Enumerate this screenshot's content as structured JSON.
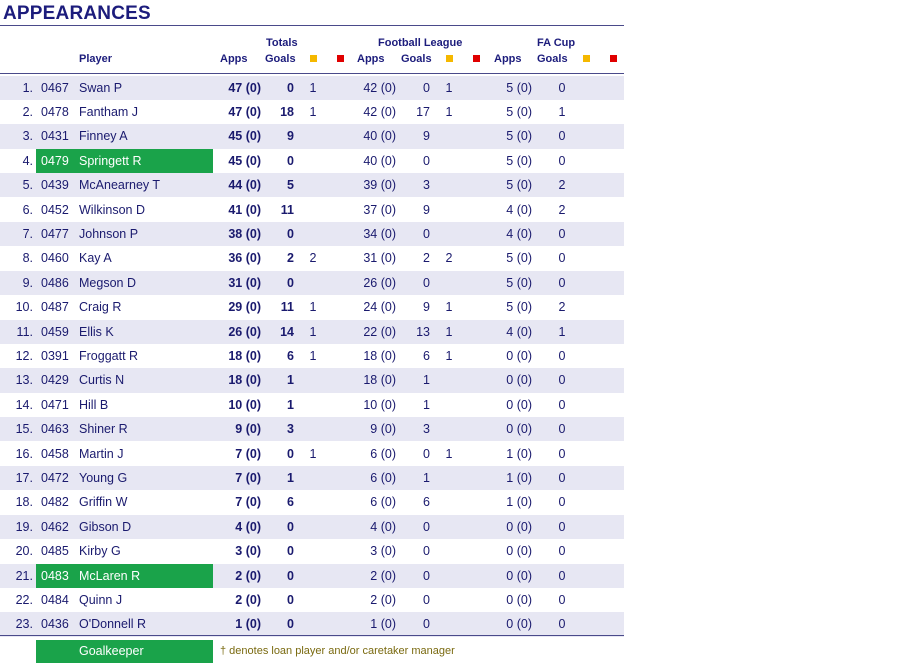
{
  "title": "APPEARANCES",
  "headers": {
    "player": "Player",
    "totals": "Totals",
    "football_league": "Football League",
    "fa_cup": "FA Cup",
    "apps": "Apps",
    "goals": "Goals"
  },
  "colors": {
    "yellow_card": "#f5b800",
    "red_card": "#e00000",
    "goalkeeper": "#1aa34a",
    "alt_row": "#e7e7f3",
    "text": "#1a1a6e"
  },
  "rows": [
    {
      "rank": "1.",
      "id": "0467",
      "name": "Swan P",
      "tot_apps": "47 (0)",
      "tot_goals": "0",
      "tot_y": "1",
      "tot_r": "",
      "fl_apps": "42 (0)",
      "fl_goals": "0",
      "fl_y": "1",
      "fl_r": "",
      "fa_apps": "5 (0)",
      "fa_goals": "0",
      "fa_y": "",
      "fa_r": "",
      "gk": false
    },
    {
      "rank": "2.",
      "id": "0478",
      "name": "Fantham J",
      "tot_apps": "47 (0)",
      "tot_goals": "18",
      "tot_y": "1",
      "tot_r": "",
      "fl_apps": "42 (0)",
      "fl_goals": "17",
      "fl_y": "1",
      "fl_r": "",
      "fa_apps": "5 (0)",
      "fa_goals": "1",
      "fa_y": "",
      "fa_r": "",
      "gk": false
    },
    {
      "rank": "3.",
      "id": "0431",
      "name": "Finney A",
      "tot_apps": "45 (0)",
      "tot_goals": "9",
      "tot_y": "",
      "tot_r": "",
      "fl_apps": "40 (0)",
      "fl_goals": "9",
      "fl_y": "",
      "fl_r": "",
      "fa_apps": "5 (0)",
      "fa_goals": "0",
      "fa_y": "",
      "fa_r": "",
      "gk": false
    },
    {
      "rank": "4.",
      "id": "0479",
      "name": "Springett R",
      "tot_apps": "45 (0)",
      "tot_goals": "0",
      "tot_y": "",
      "tot_r": "",
      "fl_apps": "40 (0)",
      "fl_goals": "0",
      "fl_y": "",
      "fl_r": "",
      "fa_apps": "5 (0)",
      "fa_goals": "0",
      "fa_y": "",
      "fa_r": "",
      "gk": true
    },
    {
      "rank": "5.",
      "id": "0439",
      "name": "McAnearney T",
      "tot_apps": "44 (0)",
      "tot_goals": "5",
      "tot_y": "",
      "tot_r": "",
      "fl_apps": "39 (0)",
      "fl_goals": "3",
      "fl_y": "",
      "fl_r": "",
      "fa_apps": "5 (0)",
      "fa_goals": "2",
      "fa_y": "",
      "fa_r": "",
      "gk": false
    },
    {
      "rank": "6.",
      "id": "0452",
      "name": "Wilkinson D",
      "tot_apps": "41 (0)",
      "tot_goals": "11",
      "tot_y": "",
      "tot_r": "",
      "fl_apps": "37 (0)",
      "fl_goals": "9",
      "fl_y": "",
      "fl_r": "",
      "fa_apps": "4 (0)",
      "fa_goals": "2",
      "fa_y": "",
      "fa_r": "",
      "gk": false
    },
    {
      "rank": "7.",
      "id": "0477",
      "name": "Johnson P",
      "tot_apps": "38 (0)",
      "tot_goals": "0",
      "tot_y": "",
      "tot_r": "",
      "fl_apps": "34 (0)",
      "fl_goals": "0",
      "fl_y": "",
      "fl_r": "",
      "fa_apps": "4 (0)",
      "fa_goals": "0",
      "fa_y": "",
      "fa_r": "",
      "gk": false
    },
    {
      "rank": "8.",
      "id": "0460",
      "name": "Kay A",
      "tot_apps": "36 (0)",
      "tot_goals": "2",
      "tot_y": "2",
      "tot_r": "",
      "fl_apps": "31 (0)",
      "fl_goals": "2",
      "fl_y": "2",
      "fl_r": "",
      "fa_apps": "5 (0)",
      "fa_goals": "0",
      "fa_y": "",
      "fa_r": "",
      "gk": false
    },
    {
      "rank": "9.",
      "id": "0486",
      "name": "Megson D",
      "tot_apps": "31 (0)",
      "tot_goals": "0",
      "tot_y": "",
      "tot_r": "",
      "fl_apps": "26 (0)",
      "fl_goals": "0",
      "fl_y": "",
      "fl_r": "",
      "fa_apps": "5 (0)",
      "fa_goals": "0",
      "fa_y": "",
      "fa_r": "",
      "gk": false
    },
    {
      "rank": "10.",
      "id": "0487",
      "name": "Craig R",
      "tot_apps": "29 (0)",
      "tot_goals": "11",
      "tot_y": "1",
      "tot_r": "",
      "fl_apps": "24 (0)",
      "fl_goals": "9",
      "fl_y": "1",
      "fl_r": "",
      "fa_apps": "5 (0)",
      "fa_goals": "2",
      "fa_y": "",
      "fa_r": "",
      "gk": false
    },
    {
      "rank": "11.",
      "id": "0459",
      "name": "Ellis K",
      "tot_apps": "26 (0)",
      "tot_goals": "14",
      "tot_y": "1",
      "tot_r": "",
      "fl_apps": "22 (0)",
      "fl_goals": "13",
      "fl_y": "1",
      "fl_r": "",
      "fa_apps": "4 (0)",
      "fa_goals": "1",
      "fa_y": "",
      "fa_r": "",
      "gk": false
    },
    {
      "rank": "12.",
      "id": "0391",
      "name": "Froggatt R",
      "tot_apps": "18 (0)",
      "tot_goals": "6",
      "tot_y": "1",
      "tot_r": "",
      "fl_apps": "18 (0)",
      "fl_goals": "6",
      "fl_y": "1",
      "fl_r": "",
      "fa_apps": "0 (0)",
      "fa_goals": "0",
      "fa_y": "",
      "fa_r": "",
      "gk": false
    },
    {
      "rank": "13.",
      "id": "0429",
      "name": "Curtis N",
      "tot_apps": "18 (0)",
      "tot_goals": "1",
      "tot_y": "",
      "tot_r": "",
      "fl_apps": "18 (0)",
      "fl_goals": "1",
      "fl_y": "",
      "fl_r": "",
      "fa_apps": "0 (0)",
      "fa_goals": "0",
      "fa_y": "",
      "fa_r": "",
      "gk": false
    },
    {
      "rank": "14.",
      "id": "0471",
      "name": "Hill B",
      "tot_apps": "10 (0)",
      "tot_goals": "1",
      "tot_y": "",
      "tot_r": "",
      "fl_apps": "10 (0)",
      "fl_goals": "1",
      "fl_y": "",
      "fl_r": "",
      "fa_apps": "0 (0)",
      "fa_goals": "0",
      "fa_y": "",
      "fa_r": "",
      "gk": false
    },
    {
      "rank": "15.",
      "id": "0463",
      "name": "Shiner R",
      "tot_apps": "9 (0)",
      "tot_goals": "3",
      "tot_y": "",
      "tot_r": "",
      "fl_apps": "9 (0)",
      "fl_goals": "3",
      "fl_y": "",
      "fl_r": "",
      "fa_apps": "0 (0)",
      "fa_goals": "0",
      "fa_y": "",
      "fa_r": "",
      "gk": false
    },
    {
      "rank": "16.",
      "id": "0458",
      "name": "Martin J",
      "tot_apps": "7 (0)",
      "tot_goals": "0",
      "tot_y": "1",
      "tot_r": "",
      "fl_apps": "6 (0)",
      "fl_goals": "0",
      "fl_y": "1",
      "fl_r": "",
      "fa_apps": "1 (0)",
      "fa_goals": "0",
      "fa_y": "",
      "fa_r": "",
      "gk": false
    },
    {
      "rank": "17.",
      "id": "0472",
      "name": "Young G",
      "tot_apps": "7 (0)",
      "tot_goals": "1",
      "tot_y": "",
      "tot_r": "",
      "fl_apps": "6 (0)",
      "fl_goals": "1",
      "fl_y": "",
      "fl_r": "",
      "fa_apps": "1 (0)",
      "fa_goals": "0",
      "fa_y": "",
      "fa_r": "",
      "gk": false
    },
    {
      "rank": "18.",
      "id": "0482",
      "name": "Griffin W",
      "tot_apps": "7 (0)",
      "tot_goals": "6",
      "tot_y": "",
      "tot_r": "",
      "fl_apps": "6 (0)",
      "fl_goals": "6",
      "fl_y": "",
      "fl_r": "",
      "fa_apps": "1 (0)",
      "fa_goals": "0",
      "fa_y": "",
      "fa_r": "",
      "gk": false
    },
    {
      "rank": "19.",
      "id": "0462",
      "name": "Gibson D",
      "tot_apps": "4 (0)",
      "tot_goals": "0",
      "tot_y": "",
      "tot_r": "",
      "fl_apps": "4 (0)",
      "fl_goals": "0",
      "fl_y": "",
      "fl_r": "",
      "fa_apps": "0 (0)",
      "fa_goals": "0",
      "fa_y": "",
      "fa_r": "",
      "gk": false
    },
    {
      "rank": "20.",
      "id": "0485",
      "name": "Kirby G",
      "tot_apps": "3 (0)",
      "tot_goals": "0",
      "tot_y": "",
      "tot_r": "",
      "fl_apps": "3 (0)",
      "fl_goals": "0",
      "fl_y": "",
      "fl_r": "",
      "fa_apps": "0 (0)",
      "fa_goals": "0",
      "fa_y": "",
      "fa_r": "",
      "gk": false
    },
    {
      "rank": "21.",
      "id": "0483",
      "name": "McLaren R",
      "tot_apps": "2 (0)",
      "tot_goals": "0",
      "tot_y": "",
      "tot_r": "",
      "fl_apps": "2 (0)",
      "fl_goals": "0",
      "fl_y": "",
      "fl_r": "",
      "fa_apps": "0 (0)",
      "fa_goals": "0",
      "fa_y": "",
      "fa_r": "",
      "gk": true
    },
    {
      "rank": "22.",
      "id": "0484",
      "name": "Quinn J",
      "tot_apps": "2 (0)",
      "tot_goals": "0",
      "tot_y": "",
      "tot_r": "",
      "fl_apps": "2 (0)",
      "fl_goals": "0",
      "fl_y": "",
      "fl_r": "",
      "fa_apps": "0 (0)",
      "fa_goals": "0",
      "fa_y": "",
      "fa_r": "",
      "gk": false
    },
    {
      "rank": "23.",
      "id": "0436",
      "name": "O'Donnell R",
      "tot_apps": "1 (0)",
      "tot_goals": "0",
      "tot_y": "",
      "tot_r": "",
      "fl_apps": "1 (0)",
      "fl_goals": "0",
      "fl_y": "",
      "fl_r": "",
      "fa_apps": "0 (0)",
      "fa_goals": "0",
      "fa_y": "",
      "fa_r": "",
      "gk": false
    }
  ],
  "footer": {
    "goalkeeper_label": "Goalkeeper",
    "note": "† denotes loan player and/or caretaker manager"
  }
}
